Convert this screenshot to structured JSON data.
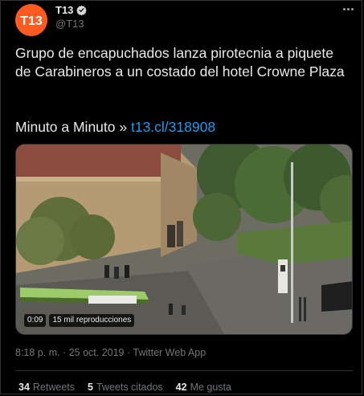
{
  "account": {
    "display_name": "T13",
    "handle": "@T13",
    "avatar_text": "T13",
    "avatar_color": "#ff5a1f",
    "verified": true
  },
  "tweet": {
    "text": "Grupo de encapuchados lanza pirotecnia a piquete de Carabineros a un costado del hotel Crowne Plaza",
    "link_prefix": "Minuto a Minuto »",
    "link_text": "t13.cl/318908",
    "link_color": "#1d9bf0"
  },
  "media": {
    "duration": "0:09",
    "views": "15 mil reproducciones"
  },
  "meta": {
    "timestamp_line": "8:18 p. m. · 25 oct. 2019 · Twitter Web App"
  },
  "stats": {
    "retweets_count": "34",
    "retweets_label": "Retweets",
    "quotes_count": "5",
    "quotes_label": "Tweets citados",
    "likes_count": "42",
    "likes_label": "Me gusta"
  }
}
